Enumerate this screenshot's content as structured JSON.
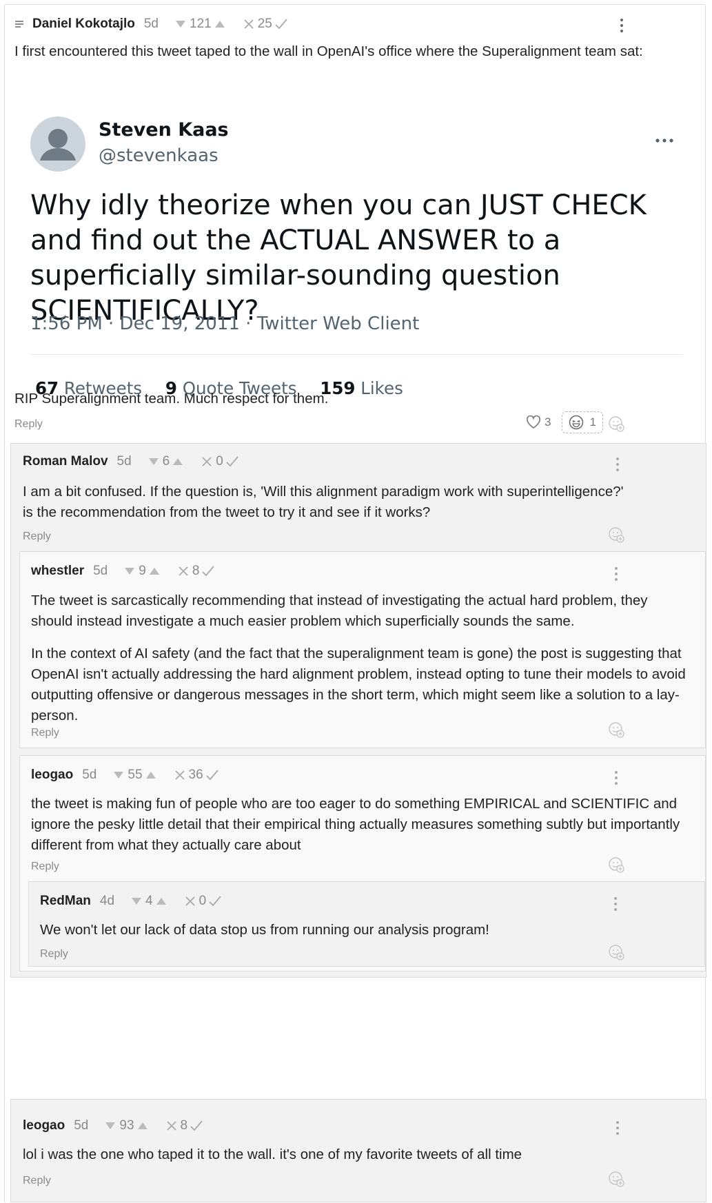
{
  "top_comment": {
    "author": "Daniel Kokotajlo",
    "date": "5d",
    "karma": "121",
    "agreement": "25",
    "intro": "I first encountered this tweet taped to the wall in OpenAI's office where the Superalignment team sat:",
    "tweet": {
      "name": "Steven Kaas",
      "handle": "@stevenkaas",
      "text": "Why idly theorize when you can JUST CHECK and find out the ACTUAL ANSWER to a superficially similar-sounding question SCIENTIFICALLY?",
      "time": "1:56 PM · Dec 19, 2011 · Twitter Web Client",
      "retweets_count": "67",
      "retweets_label": "Retweets",
      "quotes_count": "9",
      "quotes_label": "Quote Tweets",
      "likes_count": "159",
      "likes_label": "Likes"
    },
    "outro": "RIP Superalignment team. Much respect for them.",
    "reply_label": "Reply",
    "hearts": "3",
    "laughs": "1"
  },
  "replies": [
    {
      "author": "Roman Malov",
      "date": "5d",
      "karma": "6",
      "agreement": "0",
      "paragraphs": [
        "I am a bit confused. If the question is, 'Will this alignment paradigm work with superintelligence?' is the recommendation from the tweet to try it and see if it works?"
      ],
      "reply_label": "Reply"
    },
    {
      "author": "whestler",
      "date": "5d",
      "karma": "9",
      "agreement": "8",
      "paragraphs": [
        "The tweet is sarcastically recommending that instead of investigating the actual hard problem, they should instead investigate a much easier problem which superficially sounds the same.",
        "In the context of AI safety (and the fact that the superalignment team is gone) the post is suggesting that OpenAI isn't actually addressing the hard alignment problem, instead opting to tune their models to avoid outputting offensive or dangerous messages in the short term, which might seem like a solution to a lay-person."
      ],
      "reply_label": "Reply"
    },
    {
      "author": "leogao",
      "date": "5d",
      "karma": "55",
      "agreement": "36",
      "paragraphs": [
        "the tweet is making fun of people who are too eager to do something EMPIRICAL and SCIENTIFIC and ignore the pesky little detail that their empirical thing actually measures something subtly but importantly different from what they actually care about"
      ],
      "reply_label": "Reply"
    },
    {
      "author": "RedMan",
      "date": "4d",
      "karma": "4",
      "agreement": "0",
      "paragraphs": [
        "We won't let our lack of data stop us from running our analysis program!"
      ],
      "reply_label": "Reply"
    },
    {
      "author": "leogao",
      "date": "5d",
      "karma": "93",
      "agreement": "8",
      "paragraphs": [
        "lol i was the one who taped it to the wall. it's one of my favorite tweets of all time"
      ],
      "reply_label": "Reply"
    }
  ]
}
